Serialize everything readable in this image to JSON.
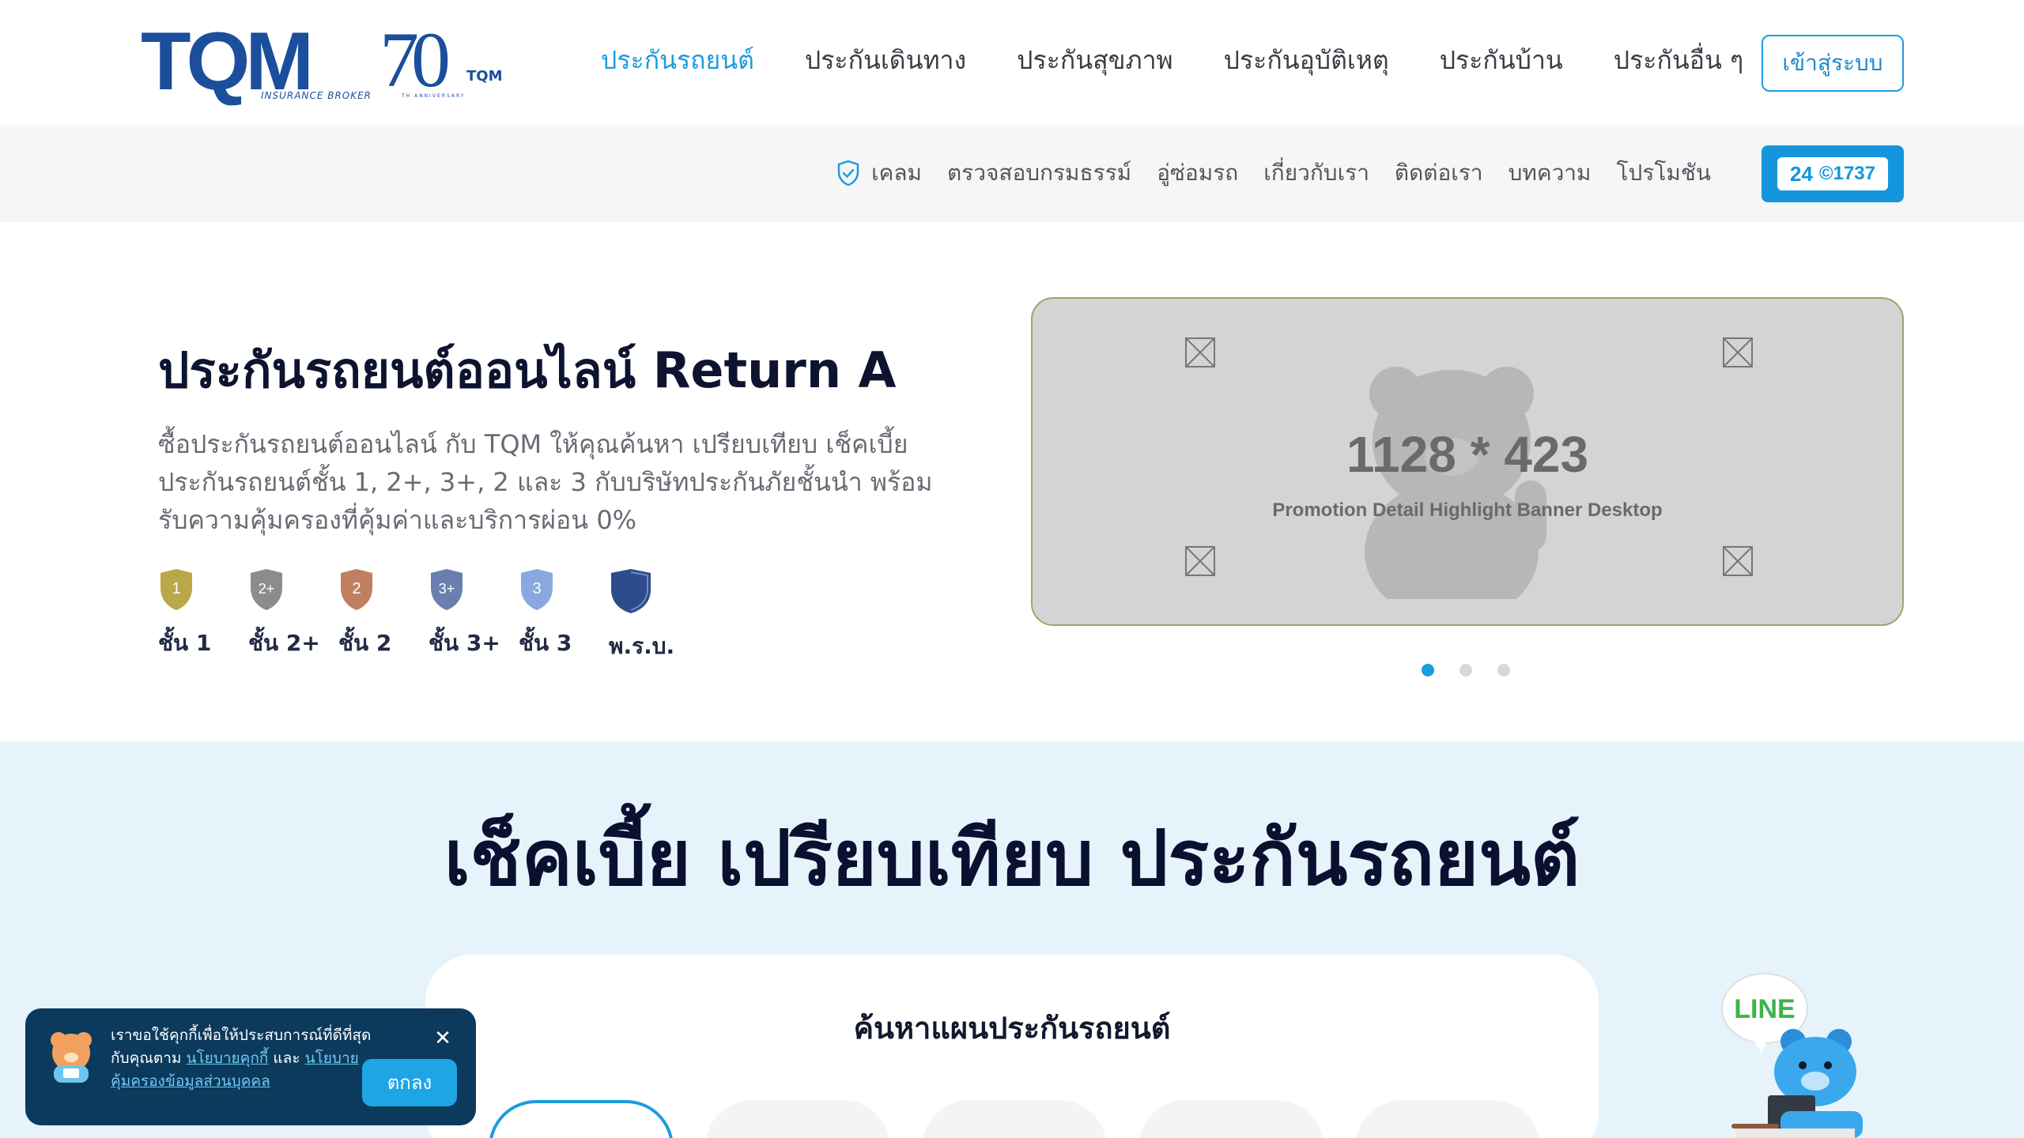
{
  "header": {
    "logo_text": "TQM",
    "logo_tagline": "INSURANCE BROKER",
    "anniversary_number": "70",
    "anniversary_small": "TQM",
    "anniversary_caption": "TH ANNIVERSARY",
    "nav": [
      {
        "label": "ประกันรถยนต์",
        "active": true
      },
      {
        "label": "ประกันเดินทาง",
        "active": false
      },
      {
        "label": "ประกันสุขภาพ",
        "active": false
      },
      {
        "label": "ประกันอุบัติเหตุ",
        "active": false
      },
      {
        "label": "ประกันบ้าน",
        "active": false
      },
      {
        "label": "ประกันอื่น ๆ",
        "active": false
      }
    ],
    "login_label": "เข้าสู่ระบบ",
    "accent_color": "#1a9de0"
  },
  "subheader": {
    "items": [
      {
        "label": "เคลม",
        "icon": "shield-check-icon"
      },
      {
        "label": "ตรวจสอบกรมธรรม์"
      },
      {
        "label": "อู่ซ่อมรถ"
      },
      {
        "label": "เกี่ยวกับเรา"
      },
      {
        "label": "ติดต่อเรา"
      },
      {
        "label": "บทความ"
      },
      {
        "label": "โปรโมชัน"
      }
    ],
    "call_badge": {
      "hours": "24",
      "number": "1737"
    }
  },
  "hero": {
    "title": "ประกันรถยนต์ออนไลน์ Return A",
    "description": "ซื้อประกันรถยนต์ออนไลน์ กับ TQM ให้คุณค้นหา เปรียบเทียบ เช็คเบี้ยประกันรถยนต์ชั้น 1, 2+, 3+, 2 และ 3 กับบริษัทประกันภัยชั้นนำ พร้อมรับความคุ้มครองที่คุ้มค่าและบริการผ่อน 0%",
    "levels": [
      {
        "badge": "1",
        "label": "ชั้น 1",
        "color": "#b8a848"
      },
      {
        "badge": "2+",
        "label": "ชั้น 2+",
        "color": "#8c8c8c"
      },
      {
        "badge": "2",
        "label": "ชั้น 2",
        "color": "#c08060"
      },
      {
        "badge": "3+",
        "label": "ชั้น 3+",
        "color": "#6a7fb0"
      },
      {
        "badge": "3",
        "label": "ชั้น 3",
        "color": "#8aa8e0"
      },
      {
        "badge": "",
        "label": "พ.ร.บ.",
        "color": "#2e4c8c"
      }
    ]
  },
  "banner": {
    "dimensions": "1128 * 423",
    "caption": "Promotion Detail Highlight Banner Desktop",
    "watermark": "TQM",
    "slides": 3,
    "active_slide": 1
  },
  "compare": {
    "title": "เช็คเบี้ย เปรียบเทียบ ประกันรถยนต์",
    "search_title": "ค้นหาแผนประกันรถยนต์",
    "tab_count": 5
  },
  "cookie": {
    "text_before": "เราขอใช้คุกกี้เพื่อให้ประสบการณ์ที่ดีที่สุดกับคุณตาม ",
    "link1": "นโยบายคุกกี้",
    "text_mid": " และ ",
    "link2": "นโยบายคุ้มครองข้อมูลส่วนบุคคล",
    "accept_label": "ตกลง",
    "close_symbol": "✕"
  },
  "line": {
    "label": "LINE"
  }
}
